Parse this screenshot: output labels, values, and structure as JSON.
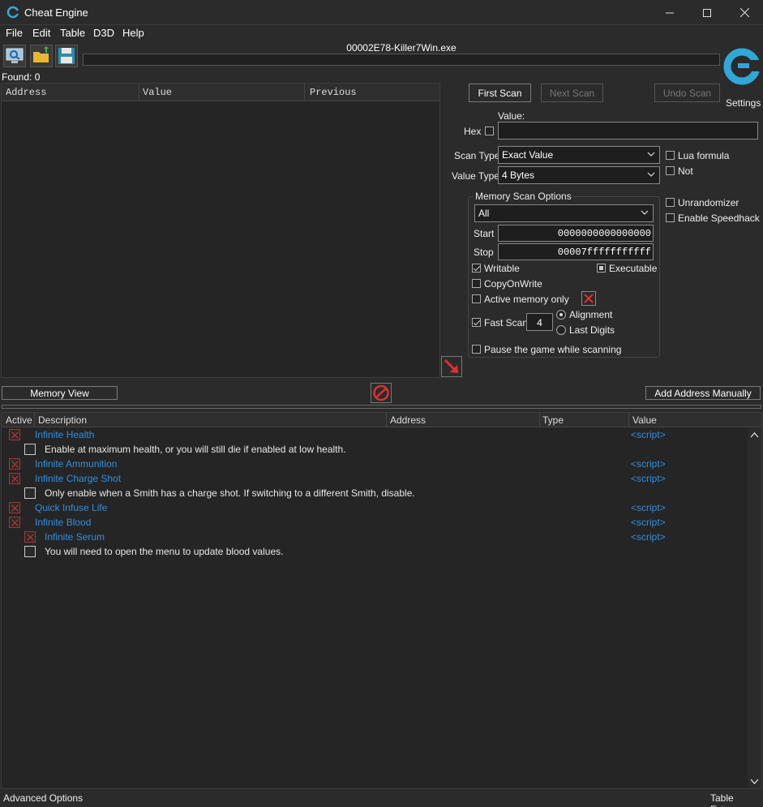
{
  "window": {
    "title": "Cheat Engine"
  },
  "menu": {
    "file": "File",
    "edit": "Edit",
    "table": "Table",
    "d3d": "D3D",
    "help": "Help"
  },
  "toolbar": {
    "process": "00002E78-Killer7Win.exe",
    "settings_label": "Settings"
  },
  "found": "Found: 0",
  "address_list": {
    "col_address": "Address",
    "col_value": "Value",
    "col_previous": "Previous"
  },
  "scan": {
    "first_scan": "First Scan",
    "next_scan": "Next Scan",
    "undo_scan": "Undo Scan",
    "value_label": "Value:",
    "value": "",
    "hex_label": "Hex",
    "scan_type_label": "Scan Type",
    "scan_type": "Exact Value",
    "value_type_label": "Value Type",
    "value_type": "4 Bytes",
    "lua_formula": "Lua formula",
    "not": "Not",
    "unrandomizer": "Unrandomizer",
    "speedhack": "Enable Speedhack"
  },
  "mso": {
    "title": "Memory Scan Options",
    "region": "All",
    "start_label": "Start",
    "start": "0000000000000000",
    "stop_label": "Stop",
    "stop": "00007fffffffffff",
    "writable": "Writable",
    "executable": "Executable",
    "copyonwrite": "CopyOnWrite",
    "active_memory": "Active memory only",
    "fast_scan": "Fast Scan",
    "fast_scan_value": "4",
    "alignment": "Alignment",
    "last_digits": "Last Digits",
    "pause_game": "Pause the game while scanning"
  },
  "mid": {
    "memory_view": "Memory View",
    "add_address": "Add Address Manually"
  },
  "cheat_table": {
    "col_active": "Active",
    "col_description": "Description",
    "col_address": "Address",
    "col_type": "Type",
    "col_value": "Value",
    "rows": [
      {
        "desc": "Infinite Health",
        "value": "<script>"
      },
      {
        "desc": "Enable at maximum health, or you will still die if enabled at low health.",
        "value": ""
      },
      {
        "desc": "Infinite Ammunition",
        "value": "<script>"
      },
      {
        "desc": "Infinite Charge Shot",
        "value": "<script>"
      },
      {
        "desc": "Only enable when a Smith has a charge shot. If switching to a different Smith, disable.",
        "value": ""
      },
      {
        "desc": "Quick Infuse Life",
        "value": "<script>"
      },
      {
        "desc": "Infinite Blood",
        "value": "<script>"
      },
      {
        "desc": "Infinite Serum",
        "value": "<script>"
      },
      {
        "desc": "You will need to open the menu to update blood values.",
        "value": ""
      }
    ]
  },
  "status": {
    "advanced": "Advanced Options",
    "extras": "Table Extras"
  },
  "colors": {
    "link": "#2f8fe0",
    "bg": "#2b2b2b",
    "x_red": "#e03030"
  }
}
